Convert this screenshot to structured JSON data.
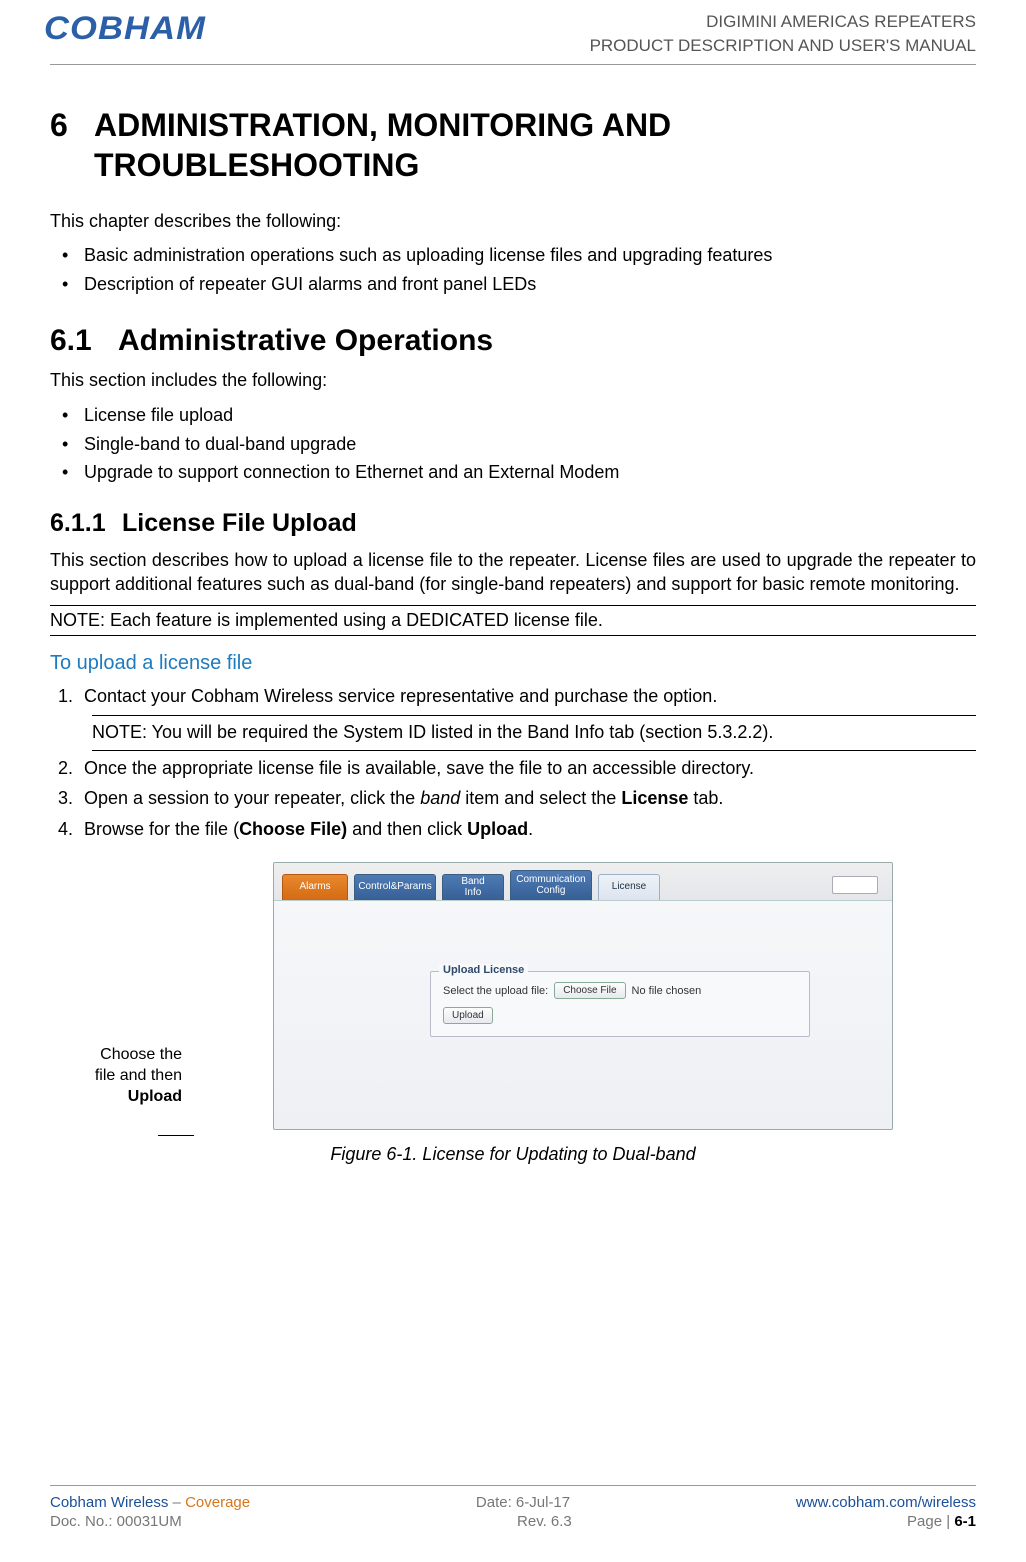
{
  "header": {
    "logo_text": "COBHAM",
    "line1": "DIGIMINI AMERICAS REPEATERS",
    "line2": "PRODUCT DESCRIPTION AND USER'S MANUAL"
  },
  "chapter": {
    "num": "6",
    "title_line1": "ADMINISTRATION, MONITORING AND",
    "title_line2": "TROUBLESHOOTING"
  },
  "intro": "This chapter describes the following:",
  "intro_bullets": [
    "Basic administration operations such as uploading license files and upgrading features",
    "Description of repeater GUI alarms and front panel LEDs"
  ],
  "section": {
    "num": "6.1",
    "title": "Administrative Operations",
    "intro": "This section includes the following:",
    "bullets": [
      "License file upload",
      "Single-band to dual-band upgrade",
      "Upgrade to support connection to Ethernet and an External Modem"
    ]
  },
  "subsection": {
    "num": "6.1.1",
    "title": "License File Upload",
    "para": "This section describes how to upload a license file to the repeater. License files are used to upgrade the repeater to support additional features such as dual-band (for single-band repeaters) and support for basic remote monitoring.",
    "note": "NOTE: Each feature is implemented using a DEDICATED license file.",
    "procedure_title": "To upload a license file",
    "steps": {
      "s1": "Contact your Cobham Wireless service representative and purchase the option.",
      "s1_note": "NOTE: You will be required the System ID listed in the Band Info tab (section 5.3.2.2).",
      "s2": "Once the appropriate license file is available, save the file to an accessible directory.",
      "s3_pre": "Open a session to your repeater, click the ",
      "s3_em": "band",
      "s3_mid": " item and select the ",
      "s3_b": "License",
      "s3_post": " tab.",
      "s4_pre": "Browse for the file (",
      "s4_b1": "Choose File)",
      "s4_mid": " and then click ",
      "s4_b2": "Upload",
      "s4_post": "."
    }
  },
  "callout": {
    "line1": "Choose the",
    "line2": "file and then",
    "line3_b": "Upload"
  },
  "screenshot": {
    "tabs": {
      "alarms": "Alarms",
      "control": "Control&Params",
      "bandinfo": "Band Info",
      "comm": "Communication Config",
      "license": "License"
    },
    "fieldset": {
      "legend": "Upload License",
      "label": "Select the upload file:",
      "choose_btn": "Choose File",
      "no_file": "No file chosen",
      "upload_btn": "Upload"
    }
  },
  "figure_caption": "Figure 6-1. License for Updating to Dual-band",
  "footer": {
    "l1_left_a": "Cobham Wireless",
    "l1_left_sep": " – ",
    "l1_left_b": "Coverage",
    "l1_mid": "Date: 6-Jul-17",
    "l1_right": "www.cobham.com/wireless",
    "l2_left": "Doc. No.: 00031UM",
    "l2_mid": "Rev. 6.3",
    "l2_right_pre": "Page | ",
    "l2_right_num": "6-1"
  }
}
